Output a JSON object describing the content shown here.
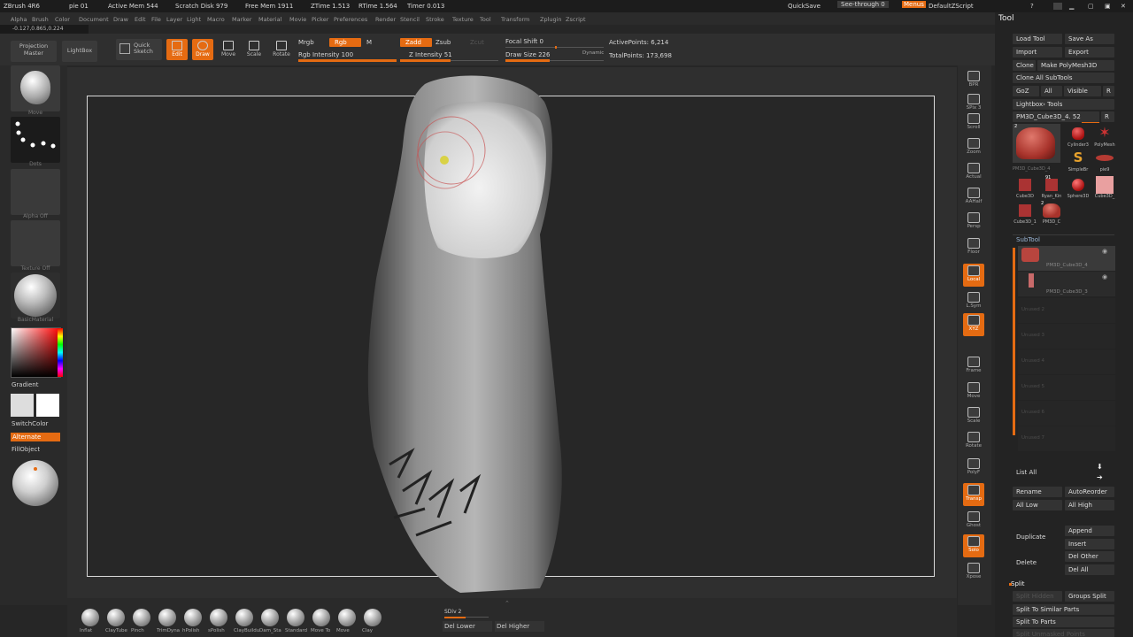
{
  "titlebar": {
    "app": "ZBrush 4R6",
    "doc": "pie 01",
    "active_mem": "Active Mem 544",
    "scratch": "Scratch Disk 979",
    "free_mem": "Free Mem 1911",
    "ztime": "ZTime 1.513",
    "rtime": "RTime 1.564",
    "timer": "Timer 0.013",
    "quicksave": "QuickSave",
    "seethrough": "See-through 0",
    "menus": "Menus",
    "script": "DefaultZScript"
  },
  "menubar": [
    "Alpha",
    "Brush",
    "Color",
    "Document",
    "Draw",
    "Edit",
    "File",
    "Layer",
    "Light",
    "Macro",
    "Marker",
    "Material",
    "Movie",
    "Picker",
    "Preferences",
    "Render",
    "Stencil",
    "Stroke",
    "Texture",
    "Tool",
    "Transform",
    "Zplugin",
    "Zscript"
  ],
  "coords": "-0.127,0.865,0.224",
  "toolbar": {
    "projection_master": "Projection Master",
    "lightbox": "LightBox",
    "quick_sketch": "Quick Sketch",
    "edit": "Edit",
    "draw": "Draw",
    "move": "Move",
    "scale": "Scale",
    "rotate": "Rotate",
    "mrgb": "Mrgb",
    "rgb": "Rgb",
    "m": "M",
    "rgb_intensity": "Rgb Intensity 100",
    "zadd": "Zadd",
    "zsub": "Zsub",
    "zcut": "Zcut",
    "z_intensity": "Z Intensity 51",
    "focal_shift": "Focal Shift 0",
    "draw_size": "Draw Size 226",
    "dynamic": "Dynamic",
    "active_points": "ActivePoints: 6,214",
    "total_points": "TotalPoints: 173,698",
    "rgb_intensity_value": 1.0,
    "z_intensity_value": 0.51,
    "focal_shift_value": 0.5,
    "draw_size_value": 0.45
  },
  "leftshelf": {
    "brush_cap": "Move",
    "stroke_cap": "Dots",
    "alpha_cap": "Alpha Off",
    "texture_cap": "Texture Off",
    "material_cap": "BasicMaterial",
    "gradient": "Gradient",
    "switchcolor": "SwitchColor",
    "alternate": "Alternate",
    "fillobject": "FillObject"
  },
  "rightshelf": [
    {
      "label": "BPR",
      "on": false
    },
    {
      "label": "SPix 3",
      "on": false
    },
    {
      "label": "Scroll",
      "on": false
    },
    {
      "label": "Zoom",
      "on": false
    },
    {
      "label": "Actual",
      "on": false
    },
    {
      "label": "AAHalf",
      "on": false
    },
    {
      "label": "Persp",
      "on": false
    },
    {
      "label": "Floor",
      "on": false
    },
    {
      "label": "Local",
      "on": true
    },
    {
      "label": "L.Sym",
      "on": false
    },
    {
      "label": "XYZ",
      "on": true
    },
    {
      "label": "Frame",
      "on": false
    },
    {
      "label": "Move",
      "on": false
    },
    {
      "label": "Scale",
      "on": false
    },
    {
      "label": "Rotate",
      "on": false
    },
    {
      "label": "PolyF",
      "on": false
    },
    {
      "label": "Transp",
      "on": true
    },
    {
      "label": "Ghost",
      "on": false
    },
    {
      "label": "Solo",
      "on": true
    },
    {
      "label": "Xpose",
      "on": false
    }
  ],
  "panel": {
    "title": "Tool",
    "load_tool": "Load Tool",
    "save_as": "Save As",
    "import": "Import",
    "export": "Export",
    "clone": "Clone",
    "make_polymesh": "Make PolyMesh3D",
    "clone_all": "Clone All SubTools",
    "goz": "GoZ",
    "all": "All",
    "visible": "Visible",
    "r": "R",
    "lightbox_tools": "Lightbox› Tools",
    "current_tool": "PM3D_Cube3D_4. 52",
    "tool_count": "2",
    "tool_thumbs": [
      {
        "name": "Cylinder3",
        "kind": "cyl"
      },
      {
        "name": "PolyMesh",
        "kind": "star"
      },
      {
        "name": "SimpleBr",
        "kind": "s"
      },
      {
        "name": "pie9",
        "kind": "pie"
      },
      {
        "name": "Cube3D",
        "kind": "cube"
      },
      {
        "name": "Ryan_Kin",
        "kind": "cube"
      },
      {
        "name": "Sphere3D",
        "kind": "sphere"
      },
      {
        "name": "Cube3D_",
        "kind": "pink"
      },
      {
        "name": "Cube3D_1",
        "kind": "cube"
      },
      {
        "name": "PM3D_C",
        "kind": "foot"
      }
    ],
    "selected_tool_name": "PM3D_Cube3D_4",
    "ryan_count": "91",
    "pm_count": "2",
    "subtool_header": "SubTool",
    "subtools": [
      {
        "name": "PM3D_Cube3D_4"
      },
      {
        "name": "PM3D_Cube3D_3"
      }
    ],
    "unused": [
      "Unused 2",
      "Unused 3",
      "Unused 4",
      "Unused 5",
      "Unused 6",
      "Unused 7"
    ],
    "list_all": "List All",
    "rename": "Rename",
    "autoreorder": "AutoReorder",
    "all_low": "All Low",
    "all_high": "All High",
    "duplicate": "Duplicate",
    "append": "Append",
    "insert": "Insert",
    "delete": "Delete",
    "del_other": "Del Other",
    "del_all": "Del All",
    "split": "Split",
    "split_hidden": "Split Hidden",
    "groups_split": "Groups Split",
    "split_similar": "Split To Similar Parts",
    "split_parts": "Split To Parts",
    "split_unmasked": "Split Unmasked Points"
  },
  "bottom": {
    "brushes": [
      "Inflat",
      "ClayTube",
      "Pinch",
      "TrimDyna",
      "hPolish",
      "sPolish",
      "ClayBuildu",
      "Dam_Sta",
      "Standard",
      "Move To",
      "Move",
      "Clay"
    ],
    "sdiv": "SDiv 2",
    "del_lower": "Del Lower",
    "del_higher": "Del Higher"
  },
  "colors": {
    "accent": "#e56b12",
    "panel": "#232323"
  }
}
